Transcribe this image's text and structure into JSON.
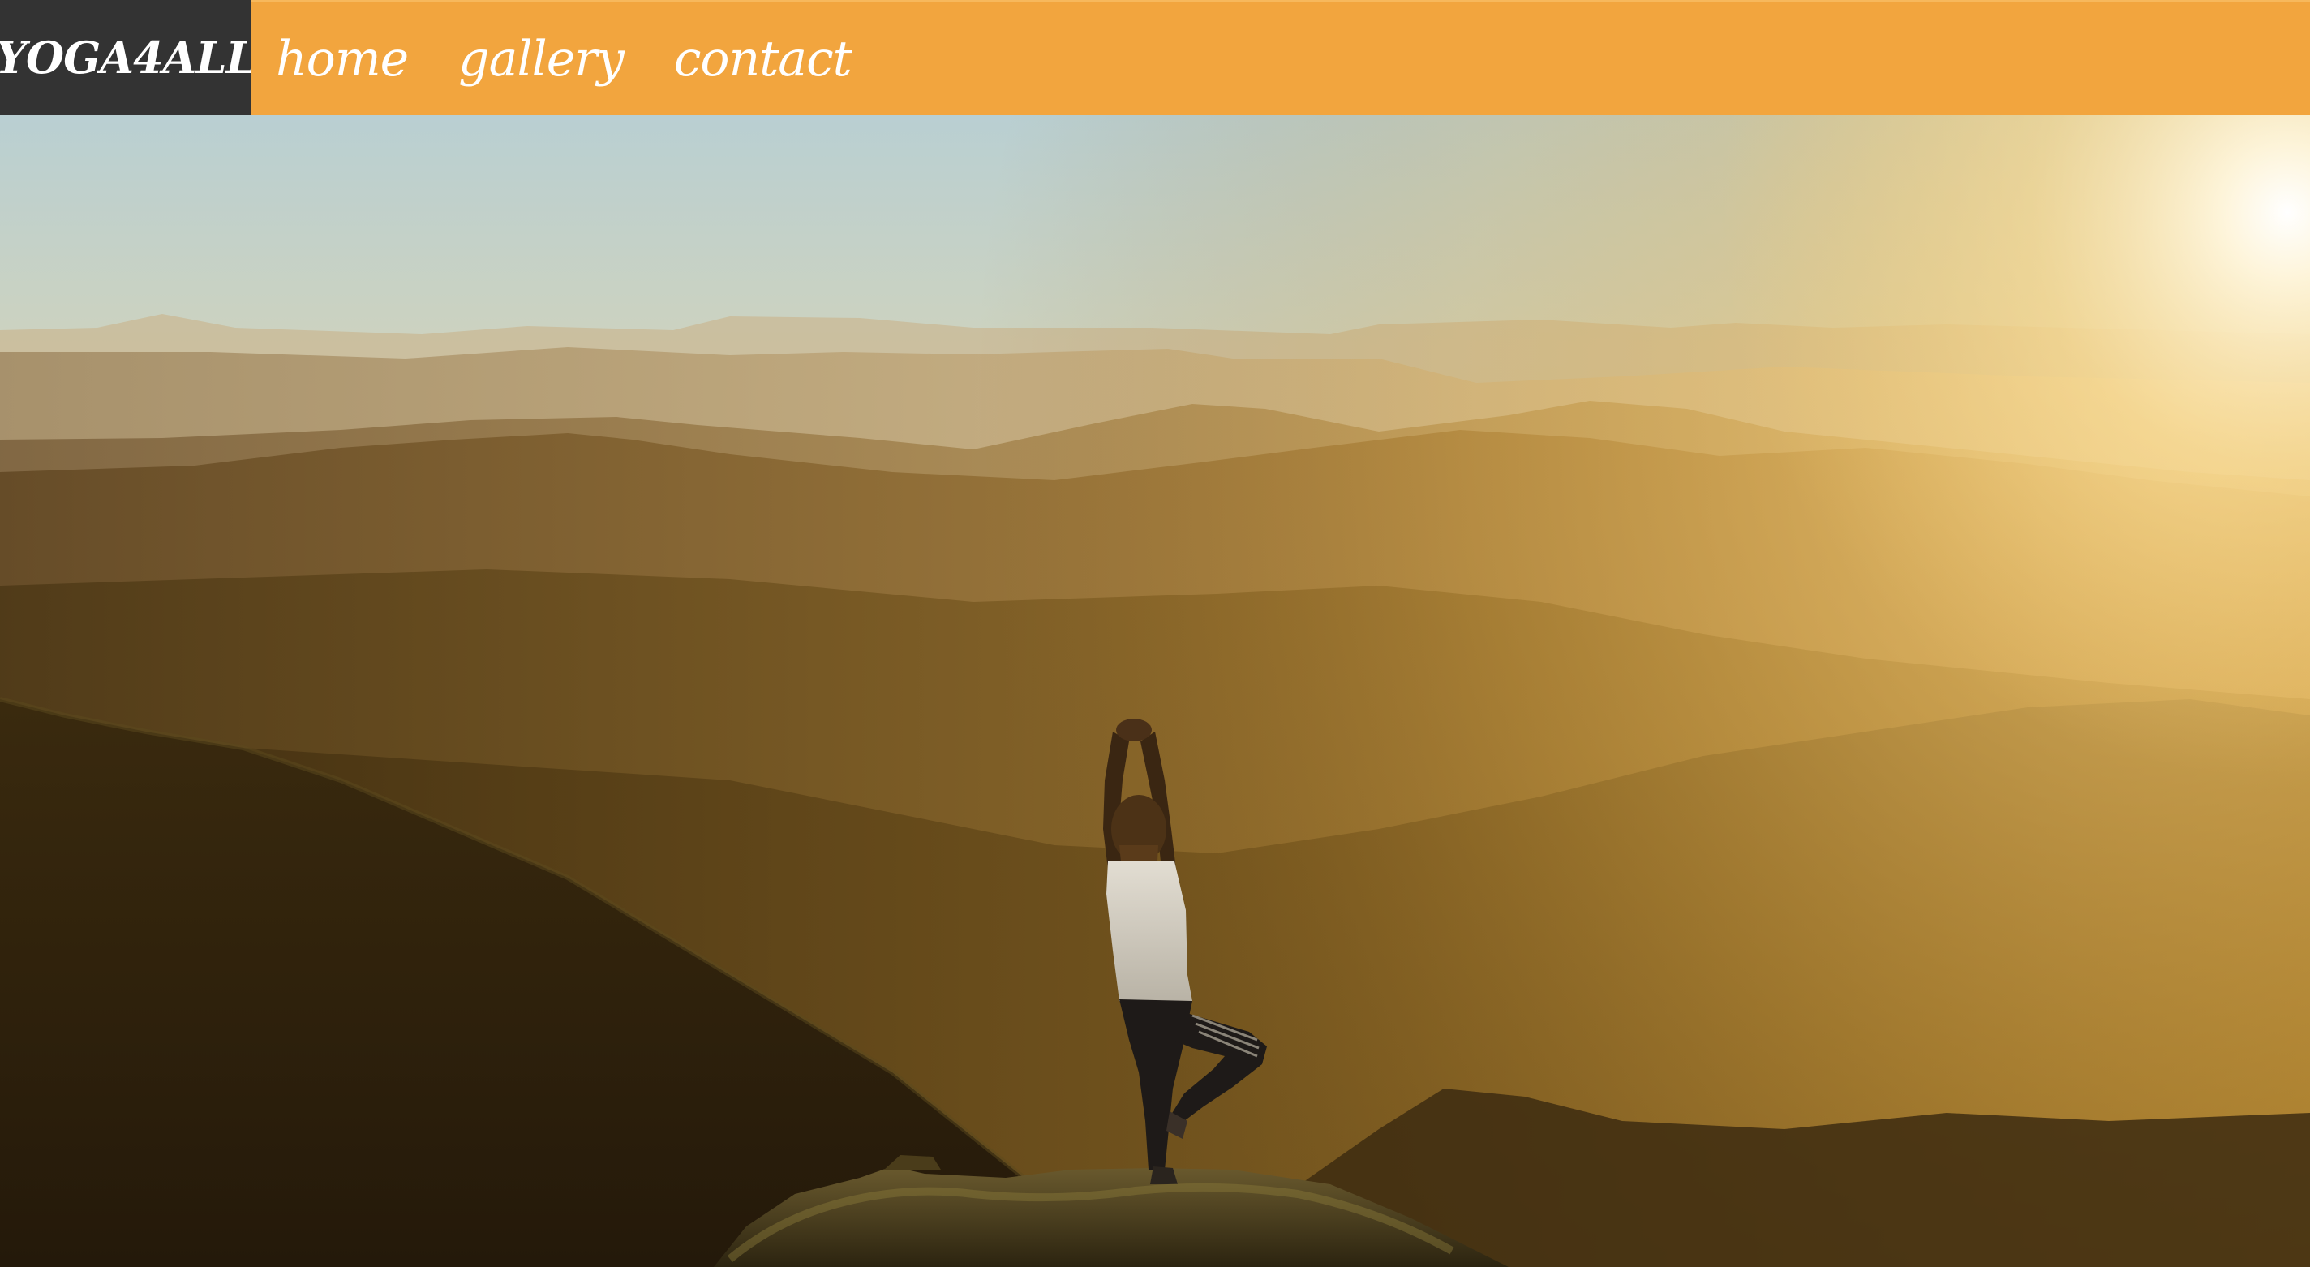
{
  "nav": {
    "brand": "YOGA4ALL",
    "links": [
      {
        "label": "home"
      },
      {
        "label": "gallery"
      },
      {
        "label": "contact"
      }
    ]
  },
  "colors": {
    "brand_bg": "#333333",
    "nav_bg": "#f2a53e",
    "nav_text": "#ffffff"
  },
  "hero": {
    "image": "sunset-mountain-yoga-tree-pose-photo"
  }
}
